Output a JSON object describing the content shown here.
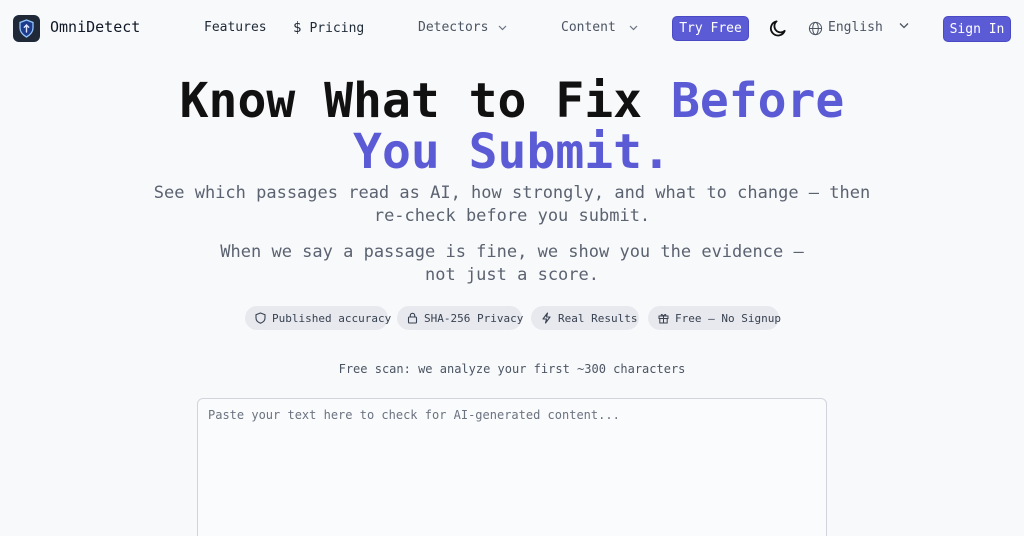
{
  "nav": {
    "brand": "OmniDetect",
    "features": "Features",
    "pricing": "Pricing",
    "detectors": "Detectors",
    "content": "Content",
    "try_free": "Try Free",
    "language": "English",
    "sign_in": "Sign In"
  },
  "hero": {
    "title_dark": "Know What to Fix ",
    "title_accent_1": "Before",
    "title_accent_2": "You Submit.",
    "subtitle_1": "See which passages read as AI, how strongly, and what to change — then re-check before you submit.",
    "subtitle_2": "When we say a passage is fine, we show you the evidence — not just a score."
  },
  "badges": {
    "accuracy": "Published accuracy",
    "privacy": "SHA-256 Privacy",
    "results": "Real Results",
    "free": "Free — No Signup"
  },
  "scan": {
    "note": "Free scan: we analyze your first ~300 characters",
    "placeholder": "Paste your text here to check for AI-generated content..."
  },
  "colors": {
    "accent": "#5b5bd6",
    "background": "#f8f9fb"
  }
}
